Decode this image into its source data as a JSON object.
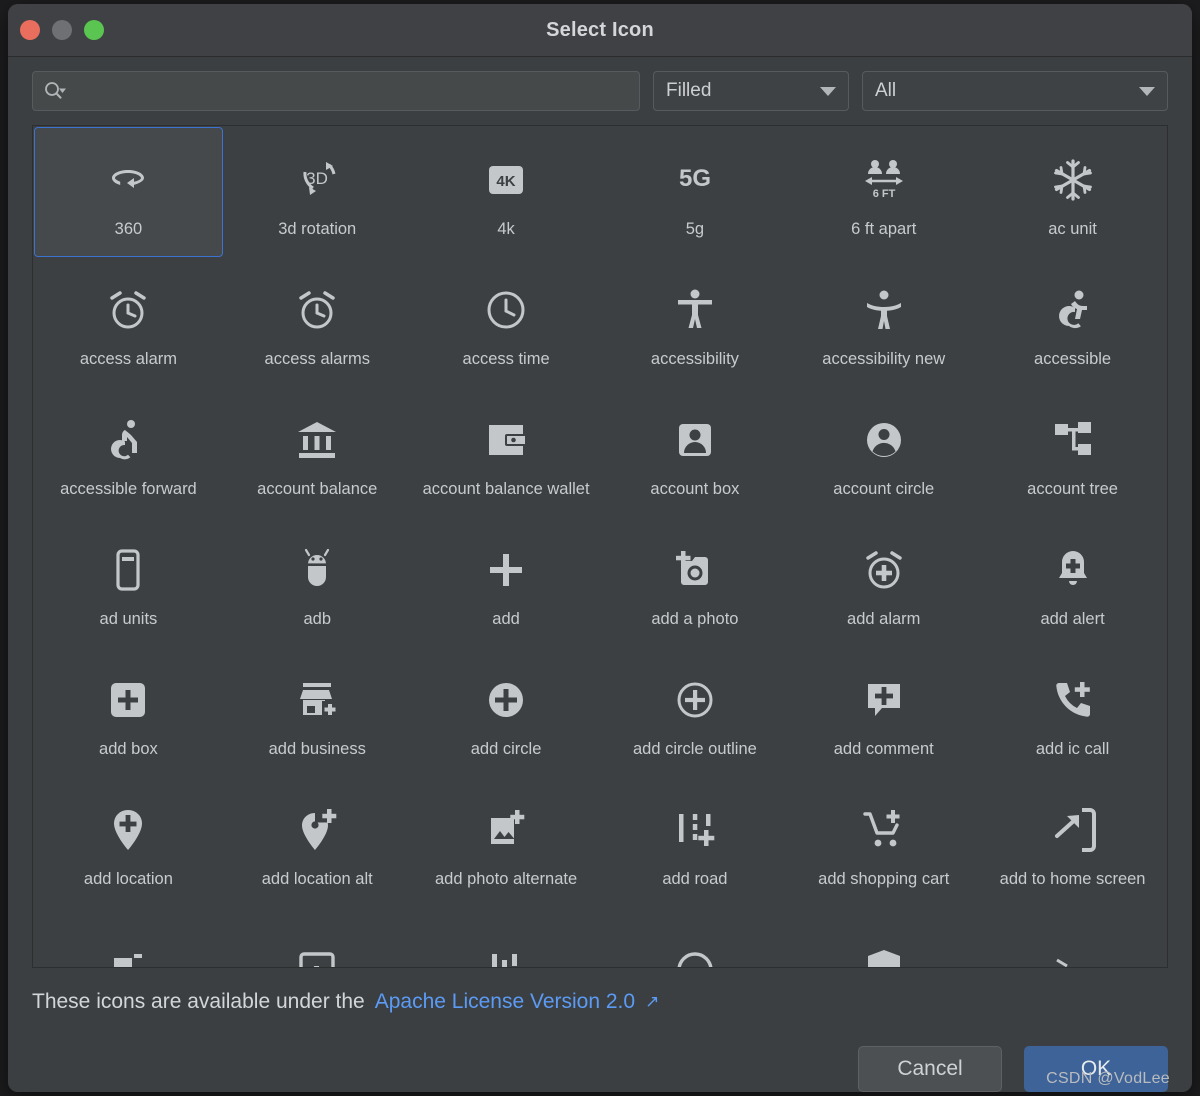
{
  "window": {
    "title": "Select Icon",
    "controls": [
      {
        "name": "close",
        "color": "#e96e5d"
      },
      {
        "name": "minimize",
        "color": "#6e7073"
      },
      {
        "name": "maximize",
        "color": "#5bc551"
      }
    ]
  },
  "toolbar": {
    "search": {
      "value": "",
      "placeholder": "",
      "icon": "search-icon"
    },
    "style_filter": {
      "value": "Filled",
      "icon": "chevron-down-icon"
    },
    "category_filter": {
      "value": "All",
      "icon": "chevron-down-icon"
    }
  },
  "grid": {
    "columns": 6,
    "selected_index": 0,
    "items": [
      {
        "label": "360",
        "icon": "rotate-360-icon"
      },
      {
        "label": "3d rotation",
        "icon": "3d-rotation-icon"
      },
      {
        "label": "4k",
        "icon": "4k-icon"
      },
      {
        "label": "5g",
        "icon": "5g-icon"
      },
      {
        "label": "6 ft apart",
        "icon": "six-ft-apart-icon"
      },
      {
        "label": "ac unit",
        "icon": "ac-unit-icon"
      },
      {
        "label": "access alarm",
        "icon": "access-alarm-icon"
      },
      {
        "label": "access alarms",
        "icon": "access-alarms-icon"
      },
      {
        "label": "access time",
        "icon": "access-time-icon"
      },
      {
        "label": "accessibility",
        "icon": "accessibility-icon"
      },
      {
        "label": "accessibility new",
        "icon": "accessibility-new-icon"
      },
      {
        "label": "accessible",
        "icon": "accessible-icon"
      },
      {
        "label": "accessible forward",
        "icon": "accessible-forward-icon"
      },
      {
        "label": "account balance",
        "icon": "account-balance-icon"
      },
      {
        "label": "account balance wallet",
        "icon": "account-balance-wallet-icon"
      },
      {
        "label": "account box",
        "icon": "account-box-icon"
      },
      {
        "label": "account circle",
        "icon": "account-circle-icon"
      },
      {
        "label": "account tree",
        "icon": "account-tree-icon"
      },
      {
        "label": "ad units",
        "icon": "ad-units-icon"
      },
      {
        "label": "adb",
        "icon": "adb-icon"
      },
      {
        "label": "add",
        "icon": "add-icon"
      },
      {
        "label": "add a photo",
        "icon": "add-a-photo-icon"
      },
      {
        "label": "add alarm",
        "icon": "add-alarm-icon"
      },
      {
        "label": "add alert",
        "icon": "add-alert-icon"
      },
      {
        "label": "add box",
        "icon": "add-box-icon"
      },
      {
        "label": "add business",
        "icon": "add-business-icon"
      },
      {
        "label": "add circle",
        "icon": "add-circle-icon"
      },
      {
        "label": "add circle outline",
        "icon": "add-circle-outline-icon"
      },
      {
        "label": "add comment",
        "icon": "add-comment-icon"
      },
      {
        "label": "add ic call",
        "icon": "add-ic-call-icon"
      },
      {
        "label": "add location",
        "icon": "add-location-icon"
      },
      {
        "label": "add location alt",
        "icon": "add-location-alt-icon"
      },
      {
        "label": "add photo alternate",
        "icon": "add-photo-alternate-icon"
      },
      {
        "label": "add road",
        "icon": "add-road-icon"
      },
      {
        "label": "add shopping cart",
        "icon": "add-shopping-cart-icon"
      },
      {
        "label": "add to home screen",
        "icon": "add-to-home-screen-icon"
      },
      {
        "label": "",
        "icon": "add-task-icon"
      },
      {
        "label": "",
        "icon": "add-to-queue-icon"
      },
      {
        "label": "",
        "icon": "addchart-icon"
      },
      {
        "label": "",
        "icon": "adjust-icon"
      },
      {
        "label": "",
        "icon": "admin-panel-settings-icon"
      },
      {
        "label": "",
        "icon": "ads-click-icon"
      }
    ]
  },
  "footer": {
    "license_text": "These icons are available under the",
    "license_link": "Apache License Version 2.0",
    "link_arrow": "↗",
    "cancel_label": "Cancel",
    "ok_label": "OK"
  },
  "watermark": "CSDN @VodLee",
  "colors": {
    "window_bg": "#3c3f41",
    "titlebar_bg": "#3f4144",
    "grid_bg": "#3c4042",
    "selection_border": "#3c72d0",
    "link": "#5b9bf5",
    "ok_button": "#3d6398",
    "icon_fill": "#c4c7ca",
    "text": "#c8cbce"
  }
}
